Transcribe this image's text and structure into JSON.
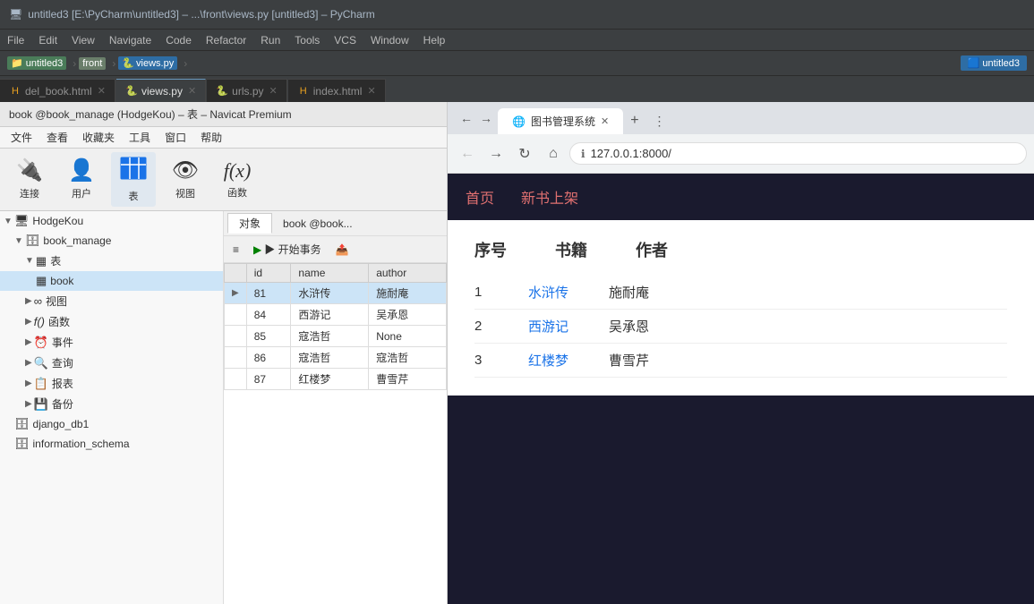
{
  "window": {
    "title": "untitled3 [E:\\PyCharm\\untitled3] – ...\\front\\views.py [untitled3] – PyCharm",
    "icon": "🖥"
  },
  "menubar": {
    "items": [
      "File",
      "Edit",
      "View",
      "Navigate",
      "Code",
      "Refactor",
      "Run",
      "Tools",
      "VCS",
      "Window",
      "Help"
    ]
  },
  "breadcrumb": {
    "project_badge": "untitled3",
    "separator1": "›",
    "front_label": "front",
    "separator2": "›",
    "file_badge": "views.py",
    "separator3": "›",
    "right_badge": "untitled3"
  },
  "tabs": [
    {
      "label": "del_book.html",
      "icon": "H",
      "active": false
    },
    {
      "label": "views.py",
      "icon": "🐍",
      "active": true
    },
    {
      "label": "urls.py",
      "icon": "🐍",
      "active": false
    },
    {
      "label": "index.html",
      "icon": "H",
      "active": false
    }
  ],
  "navicat": {
    "title": "book @book_manage (HodgeKou) – 表 – Navicat Premium",
    "menu": [
      "文件",
      "查看",
      "收藏夹",
      "工具",
      "窗口",
      "帮助"
    ],
    "toolbar": [
      {
        "icon": "🔌",
        "label": "连接"
      },
      {
        "icon": "👤",
        "label": "用户"
      },
      {
        "icon": "▦",
        "label": "表",
        "active": true
      },
      {
        "icon": "👁",
        "label": "视图"
      },
      {
        "icon": "ƒ",
        "label": "函数"
      }
    ],
    "object_tabs": [
      "对象"
    ],
    "table_toolbar": [
      "≡",
      "▶ 开始事务"
    ],
    "tree": {
      "items": [
        {
          "label": "HodgeKou",
          "icon": "🖥",
          "indent": 0,
          "arrow": "▼"
        },
        {
          "label": "book_manage",
          "icon": "🗄",
          "indent": 1,
          "arrow": "▼"
        },
        {
          "label": "表",
          "icon": "▦",
          "indent": 2,
          "arrow": "▼"
        },
        {
          "label": "book",
          "icon": "▦",
          "indent": 3,
          "selected": true
        },
        {
          "label": "视图",
          "icon": "👁",
          "indent": 2,
          "arrow": "▶"
        },
        {
          "label": "函数",
          "icon": "ƒ",
          "indent": 2,
          "arrow": "▶"
        },
        {
          "label": "事件",
          "icon": "⏰",
          "indent": 2,
          "arrow": "▶"
        },
        {
          "label": "查询",
          "icon": "🔍",
          "indent": 2,
          "arrow": "▶"
        },
        {
          "label": "报表",
          "icon": "📋",
          "indent": 2,
          "arrow": "▶"
        },
        {
          "label": "备份",
          "icon": "💾",
          "indent": 2,
          "arrow": "▶"
        },
        {
          "label": "django_db1",
          "icon": "🗄",
          "indent": 1
        },
        {
          "label": "information_schema",
          "icon": "🗄",
          "indent": 1
        }
      ]
    },
    "table_data": {
      "columns": [
        "id",
        "name",
        "author"
      ],
      "rows": [
        {
          "id": "81",
          "name": "水浒传",
          "author": "施耐庵",
          "indicator": "▶"
        },
        {
          "id": "84",
          "name": "西游记",
          "author": "吴承恩"
        },
        {
          "id": "85",
          "name": "寇浩哲",
          "author": "None"
        },
        {
          "id": "86",
          "name": "寇浩哲",
          "author": "寇浩哲"
        },
        {
          "id": "87",
          "name": "红楼梦",
          "author": "曹雪芹"
        }
      ]
    }
  },
  "browser": {
    "tab_title": "图书管理系统",
    "address": "127.0.0.1:8000/",
    "nav_items": [
      {
        "label": "首页",
        "active": false
      },
      {
        "label": "新书上架",
        "active": false
      }
    ],
    "table": {
      "headers": [
        "序号",
        "书籍",
        "作者"
      ],
      "rows": [
        {
          "num": "1",
          "title": "水浒传",
          "author": "施耐庵"
        },
        {
          "num": "2",
          "title": "西游记",
          "author": "吴承恩"
        },
        {
          "num": "3",
          "title": "红楼梦",
          "author": "曹雪芹"
        }
      ]
    }
  }
}
